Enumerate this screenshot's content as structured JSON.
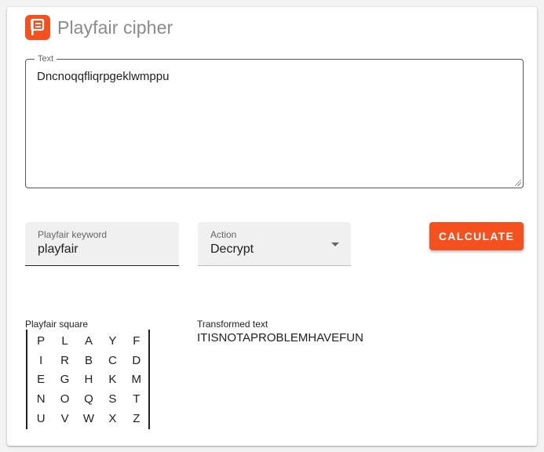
{
  "app": {
    "title": "Playfair cipher",
    "icon": "playfair-logo-icon",
    "accent_color": "#f4511e"
  },
  "text_input": {
    "label": "Text",
    "value": "Dncnoqqfliqrpgeklwmppu"
  },
  "keyword": {
    "label": "Playfair keyword",
    "value": "playfair"
  },
  "action": {
    "label": "Action",
    "selected": "Decrypt"
  },
  "calculate_label": "CALCULATE",
  "square": {
    "label": "Playfair square",
    "rows": [
      [
        "P",
        "L",
        "A",
        "Y",
        "F"
      ],
      [
        "I",
        "R",
        "B",
        "C",
        "D"
      ],
      [
        "E",
        "G",
        "H",
        "K",
        "M"
      ],
      [
        "N",
        "O",
        "Q",
        "S",
        "T"
      ],
      [
        "U",
        "V",
        "W",
        "X",
        "Z"
      ]
    ]
  },
  "result": {
    "label": "Transformed text",
    "value": "ITISNOTAPROBLEMHAVEFUN"
  }
}
